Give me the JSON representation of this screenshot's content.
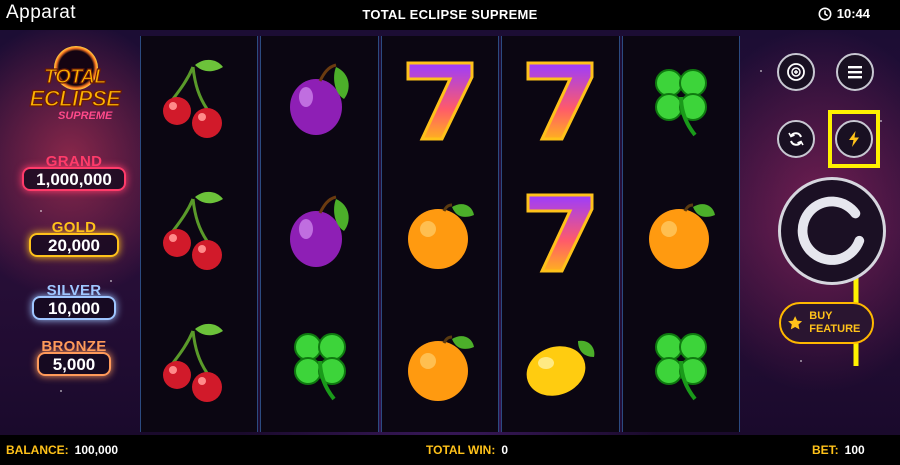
{
  "topbar": {
    "brand": "Apparat",
    "title": "TOTAL ECLIPSE SUPREME",
    "time": "10:44"
  },
  "logo": {
    "line1": "TOTAL",
    "line2": "ECLIPSE",
    "line3": "SUPREME"
  },
  "jackpots": [
    {
      "name": "GRAND",
      "value": "1,000,000"
    },
    {
      "name": "GOLD",
      "value": "20,000"
    },
    {
      "name": "SILVER",
      "value": "10,000"
    },
    {
      "name": "BRONZE",
      "value": "5,000"
    }
  ],
  "reels": [
    [
      "cherry",
      "cherry",
      "cherry"
    ],
    [
      "plum",
      "plum",
      "clover"
    ],
    [
      "seven",
      "orange",
      "orange"
    ],
    [
      "seven",
      "seven",
      "lemon"
    ],
    [
      "clover",
      "orange",
      "clover"
    ]
  ],
  "controls": {
    "chip_icon": "chip-icon",
    "menu_icon": "menu-icon",
    "autoplay_icon": "autoplay-icon",
    "turbo_icon": "lightning-icon",
    "spin_icon": "spin-icon",
    "buy_label": "BUY FEATURE"
  },
  "bottombar": {
    "balance_label": "BALANCE:",
    "balance_value": "100,000",
    "win_label": "TOTAL WIN:",
    "win_value": "0",
    "bet_label": "BET:",
    "bet_value": "100"
  },
  "annotation": {
    "highlight_color": "#fff200"
  }
}
